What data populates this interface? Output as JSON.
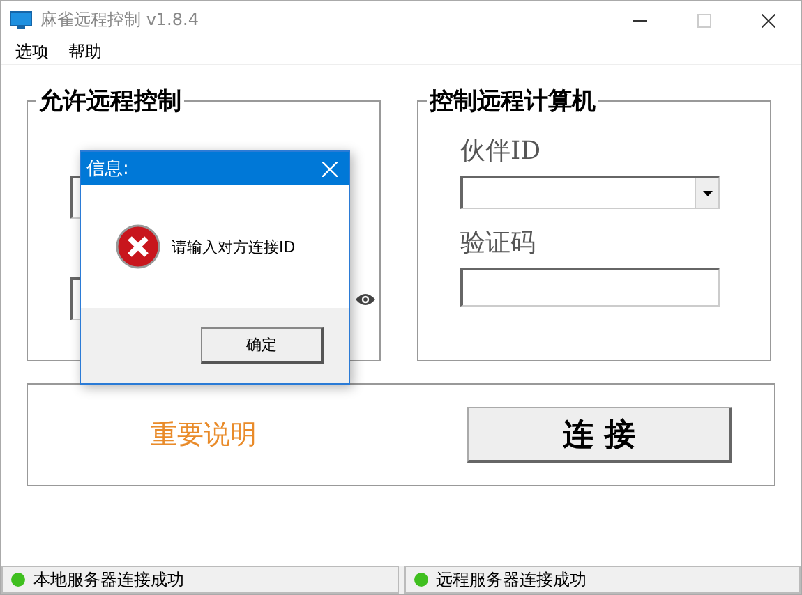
{
  "window": {
    "title": "麻雀远程控制 v1.8.4"
  },
  "menu": [
    {
      "label": "选项"
    },
    {
      "label": "帮助"
    }
  ],
  "allow_group": {
    "title": "允许远程控制"
  },
  "control_group": {
    "title": "控制远程计算机",
    "partner_label": "伙伴ID",
    "code_label": "验证码"
  },
  "notice_link": "重要说明",
  "connect_button": "连 接",
  "dialog": {
    "title": "信息:",
    "message": "请输入对方连接ID",
    "ok_button": "确定"
  },
  "status_bar": [
    {
      "text": "本地服务器连接成功",
      "color": "#3fbf1f"
    },
    {
      "text": "远程服务器连接成功",
      "color": "#3fbf1f"
    }
  ]
}
